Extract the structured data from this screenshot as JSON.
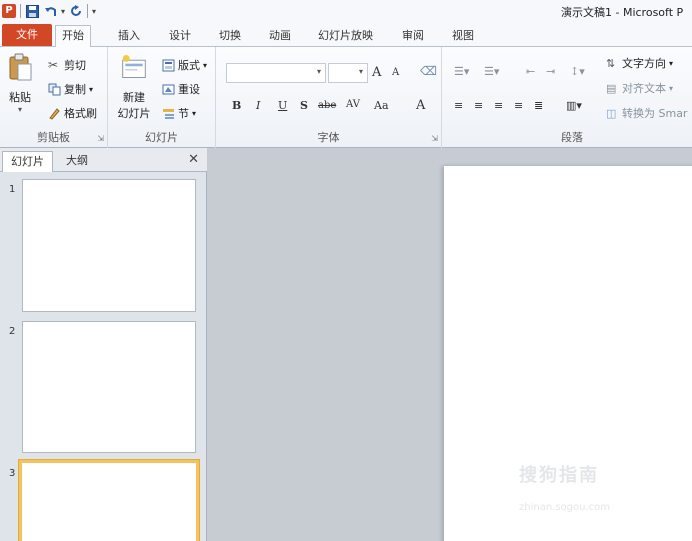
{
  "titlebar": {
    "app_logo": "P",
    "quick_access": [
      "save-icon",
      "undo-icon",
      "redo-icon",
      "customize-icon"
    ],
    "window_title": "演示文稿1 - Microsoft P"
  },
  "tabs": [
    {
      "label": "文件"
    },
    {
      "label": "开始"
    },
    {
      "label": "插入"
    },
    {
      "label": "设计"
    },
    {
      "label": "切换"
    },
    {
      "label": "动画"
    },
    {
      "label": "幻灯片放映"
    },
    {
      "label": "审阅"
    },
    {
      "label": "视图"
    }
  ],
  "ribbon": {
    "clipboard": {
      "label": "剪贴板",
      "paste": "粘贴",
      "cut": "剪切",
      "copy": "复制",
      "format_painter": "格式刷"
    },
    "slides": {
      "label": "幻灯片",
      "new_slide_line1": "新建",
      "new_slide_line2": "幻灯片",
      "layout": "版式",
      "reset": "重设",
      "section": "节"
    },
    "font": {
      "label": "字体",
      "font_name": "",
      "font_size": "",
      "grow": "A",
      "shrink": "A",
      "bold": "B",
      "italic": "I",
      "underline": "U",
      "shadow": "S",
      "strike": "abe",
      "spacing": "AV",
      "case": "Aa",
      "color": "A"
    },
    "paragraph": {
      "label": "段落",
      "text_direction": "文字方向",
      "align_text": "对齐文本",
      "convert_smartart": "转换为 Smar"
    }
  },
  "left_pane": {
    "tab_slides": "幻灯片",
    "tab_outline": "大纲",
    "close": "✕",
    "slides": [
      {
        "number": "1"
      },
      {
        "number": "2"
      },
      {
        "number": "3"
      }
    ]
  },
  "watermark": {
    "logo": "搜狗指南",
    "url": "zhinan.sogou.com"
  },
  "colors": {
    "file_tab": "#d24726",
    "selected_slide_border": "#f3c35f"
  }
}
